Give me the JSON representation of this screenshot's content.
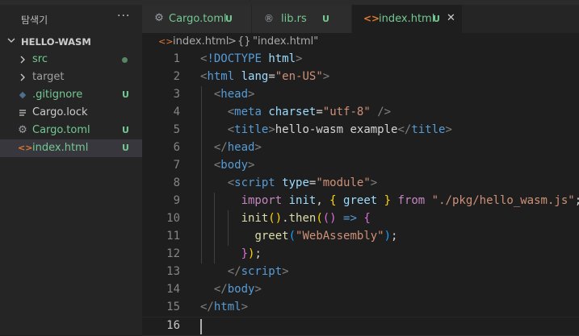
{
  "sidebar": {
    "title": "탐색기",
    "more": "···",
    "folder": "HELLO-WASM",
    "items": [
      {
        "label": "src",
        "badge": ""
      },
      {
        "label": "target",
        "badge": ""
      },
      {
        "label": ".gitignore",
        "badge": "U"
      },
      {
        "label": "Cargo.lock",
        "badge": ""
      },
      {
        "label": "Cargo.toml",
        "badge": "U"
      },
      {
        "label": "index.html",
        "badge": "U"
      }
    ]
  },
  "tabs": [
    {
      "label": "Cargo.toml",
      "badge": "U"
    },
    {
      "label": "lib.rs",
      "badge": "U"
    },
    {
      "label": "index.html",
      "badge": "U",
      "close": "✕"
    }
  ],
  "breadcrumb": {
    "file": "index.html",
    "separator": ">",
    "symbol": "{}",
    "node": "\"index.html\""
  },
  "editor": {
    "line_numbers": [
      "1",
      "2",
      "3",
      "4",
      "5",
      "6",
      "7",
      "8",
      "9",
      "10",
      "11",
      "12",
      "13",
      "14",
      "15",
      "16"
    ],
    "lines": [
      [
        [
          "tg",
          "<"
        ],
        [
          "tn",
          "!DOCTYPE"
        ],
        [
          "df",
          " "
        ],
        [
          "at",
          "html"
        ],
        [
          "tg",
          ">"
        ]
      ],
      [
        [
          "tg",
          "<"
        ],
        [
          "tn",
          "html"
        ],
        [
          "df",
          " "
        ],
        [
          "at",
          "lang"
        ],
        [
          "df",
          "="
        ],
        [
          "st",
          "\"en-US\""
        ],
        [
          "tg",
          ">"
        ]
      ],
      [
        [
          "df",
          "  "
        ],
        [
          "tg",
          "<"
        ],
        [
          "tn",
          "head"
        ],
        [
          "tg",
          ">"
        ]
      ],
      [
        [
          "df",
          "    "
        ],
        [
          "tg",
          "<"
        ],
        [
          "tn",
          "meta"
        ],
        [
          "df",
          " "
        ],
        [
          "at",
          "charset"
        ],
        [
          "df",
          "="
        ],
        [
          "st",
          "\"utf-8\""
        ],
        [
          "df",
          " "
        ],
        [
          "tg",
          "/>"
        ]
      ],
      [
        [
          "df",
          "    "
        ],
        [
          "tg",
          "<"
        ],
        [
          "tn",
          "title"
        ],
        [
          "tg",
          ">"
        ],
        [
          "df",
          "hello-wasm example"
        ],
        [
          "tg",
          "</"
        ],
        [
          "tn",
          "title"
        ],
        [
          "tg",
          ">"
        ]
      ],
      [
        [
          "df",
          "  "
        ],
        [
          "tg",
          "</"
        ],
        [
          "tn",
          "head"
        ],
        [
          "tg",
          ">"
        ]
      ],
      [
        [
          "df",
          "  "
        ],
        [
          "tg",
          "<"
        ],
        [
          "tn",
          "body"
        ],
        [
          "tg",
          ">"
        ]
      ],
      [
        [
          "df",
          "    "
        ],
        [
          "tg",
          "<"
        ],
        [
          "tn",
          "script"
        ],
        [
          "df",
          " "
        ],
        [
          "at",
          "type"
        ],
        [
          "df",
          "="
        ],
        [
          "st",
          "\"module\""
        ],
        [
          "tg",
          ">"
        ]
      ],
      [
        [
          "df",
          "      "
        ],
        [
          "kw",
          "import"
        ],
        [
          "df",
          " "
        ],
        [
          "vr",
          "init"
        ],
        [
          "df",
          ", "
        ],
        [
          "b1",
          "{"
        ],
        [
          "df",
          " "
        ],
        [
          "vr",
          "greet"
        ],
        [
          "df",
          " "
        ],
        [
          "b1",
          "}"
        ],
        [
          "df",
          " "
        ],
        [
          "kw",
          "from"
        ],
        [
          "df",
          " "
        ],
        [
          "st",
          "\"./pkg/hello_wasm.js\""
        ],
        [
          "df",
          ";"
        ]
      ],
      [
        [
          "df",
          "      "
        ],
        [
          "fn",
          "init"
        ],
        [
          "b1",
          "()"
        ],
        [
          "df",
          "."
        ],
        [
          "fn",
          "then"
        ],
        [
          "b1",
          "("
        ],
        [
          "b2",
          "()"
        ],
        [
          "df",
          " "
        ],
        [
          "tn",
          "=>"
        ],
        [
          "df",
          " "
        ],
        [
          "b2",
          "{"
        ]
      ],
      [
        [
          "df",
          "        "
        ],
        [
          "fn",
          "greet"
        ],
        [
          "b3",
          "("
        ],
        [
          "st",
          "\"WebAssembly\""
        ],
        [
          "b3",
          ")"
        ],
        [
          "df",
          ";"
        ]
      ],
      [
        [
          "df",
          "      "
        ],
        [
          "b2",
          "}"
        ],
        [
          "b1",
          ")"
        ],
        [
          "df",
          ";"
        ]
      ],
      [
        [
          "df",
          "    "
        ],
        [
          "tg",
          "</"
        ],
        [
          "tn",
          "script"
        ],
        [
          "tg",
          ">"
        ]
      ],
      [
        [
          "df",
          "  "
        ],
        [
          "tg",
          "</"
        ],
        [
          "tn",
          "body"
        ],
        [
          "tg",
          ">"
        ]
      ],
      [
        [
          "tg",
          "</"
        ],
        [
          "tn",
          "html"
        ],
        [
          "tg",
          ">"
        ]
      ],
      [
        [
          "df",
          ""
        ]
      ]
    ]
  },
  "colors": {
    "untracked": "#73c991",
    "html_icon": "#e37933",
    "active_line_number": "#c6c6c6"
  },
  "icons": [
    "chevron-down-icon",
    "chevron-right-icon",
    "gear-icon",
    "rust-icon",
    "html-icon",
    "lines-icon",
    "close-icon",
    "more-icon"
  ]
}
